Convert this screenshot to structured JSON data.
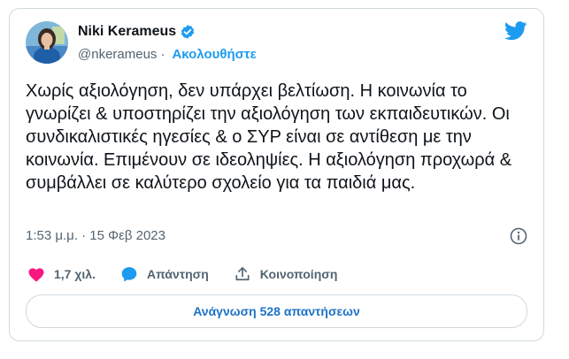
{
  "author": {
    "name": "Niki Kerameus",
    "handle": "@nkerameus",
    "separator": "·",
    "follow_label": "Ακολουθήστε"
  },
  "tweet": {
    "text": "Χωρίς αξιολόγηση, δεν υπάρχει βελτίωση. Η κοινωνία το γνωρίζει & υποστηρίζει την αξιολόγηση των εκπαιδευτικών. Οι συνδικαλιστικές ηγεσίες & ο ΣΥΡ είναι σε αντίθεση με την κοινωνία. Επιμένουν σε ιδεοληψίες. Η αξιολόγηση προχωρά & συμβάλλει σε καλύτερο σχολείο για τα παιδιά μας.",
    "timestamp": "1:53 μ.μ. · 15 Φεβ 2023"
  },
  "actions": {
    "likes": "1,7 χιλ.",
    "reply_label": "Απάντηση",
    "share_label": "Κοινοποίηση"
  },
  "replies_button": "Ανάγνωση 528 απαντήσεων",
  "colors": {
    "accent": "#1d9bf0",
    "heart": "#f91880",
    "text": "#0f1419",
    "muted": "#536471"
  },
  "icons": [
    "verified-badge-icon",
    "twitter-bird-icon",
    "info-icon",
    "heart-icon",
    "reply-bubble-icon",
    "share-icon"
  ]
}
